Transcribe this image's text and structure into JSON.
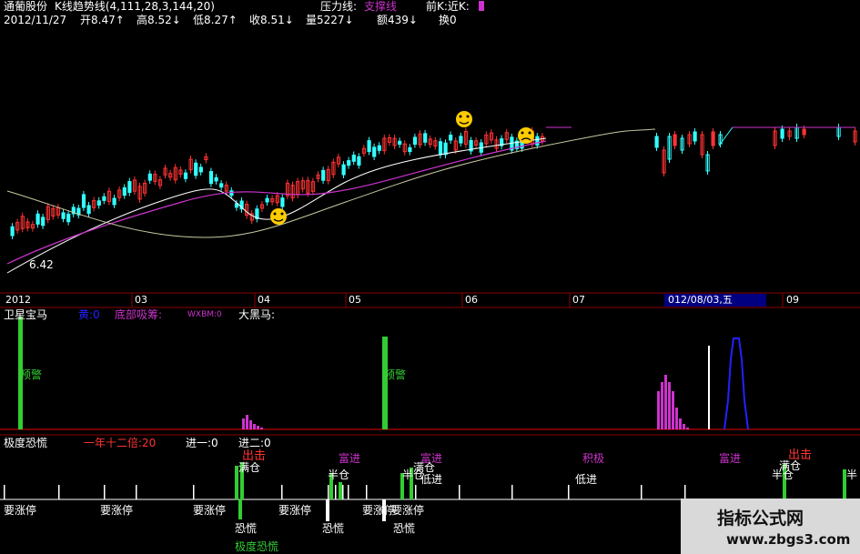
{
  "header": {
    "stock": "通葡股份",
    "indicator": "K线趋势线(4,111,28,3,144,20)",
    "pressure": "压力线:",
    "support": "支撑线",
    "near": "前K:近K:",
    "date": "2012/11/27",
    "open": "开8.47↑",
    "high": "高8.52↓",
    "low": "低8.27↑",
    "close": "收8.51↓",
    "volume": "量5227↓",
    "amount": "额439↓",
    "turnover": "换0"
  },
  "main_chart": {
    "low_label": "6.42",
    "months": [
      "2012",
      "03",
      "04",
      "05",
      "06",
      "07",
      "09"
    ],
    "cursor_date": "012/08/03,五"
  },
  "panel2": {
    "title": "卫星宝马",
    "v1": "黄:0",
    "v2": "底部吸筹:",
    "v3": "WXBM:0",
    "v4": "大黑马:",
    "alert": "预警",
    "alert2": "预警"
  },
  "panel3": {
    "title": "极度恐慌",
    "v1": "一年十二倍:20",
    "v2": "进一:0",
    "v3": "进二:0",
    "labels": {
      "chuji1": "出击",
      "chuji2": "出击",
      "mancang1": "满仓",
      "mancang2": "满仓",
      "mancang3": "满仓",
      "bancang1": "半仓",
      "bancang2": "半仓",
      "bancang3": "半仓",
      "bancang4": "半",
      "dijin1": "低进",
      "dijin2": "低进",
      "fujin1": "富进",
      "fujin2": "富进",
      "fujin3": "富进",
      "jixu": "积极",
      "zhangting1": "要涨停",
      "zhangting2": "要涨停",
      "zhangting3": "要涨停",
      "zhangting4": "要涨停",
      "zhangting5": "要涨停",
      "zhangting6": "要涨停",
      "konghuang1": "恐慌",
      "konghuang2": "恐慌",
      "konghuang3": "恐慌",
      "jidu": "极度恐慌"
    }
  },
  "watermark": {
    "title": "指标公式网",
    "url": "www.zbgs3.com"
  },
  "colors": {
    "up": "#ff3333",
    "down": "#33ffff",
    "ma1": "#ffffff",
    "ma2": "#cc33cc",
    "ma3": "#c8c8a0",
    "green": "#33cc33",
    "magenta": "#cc33cc",
    "blue": "#2222ff",
    "panel_line": "#8b0000"
  }
}
